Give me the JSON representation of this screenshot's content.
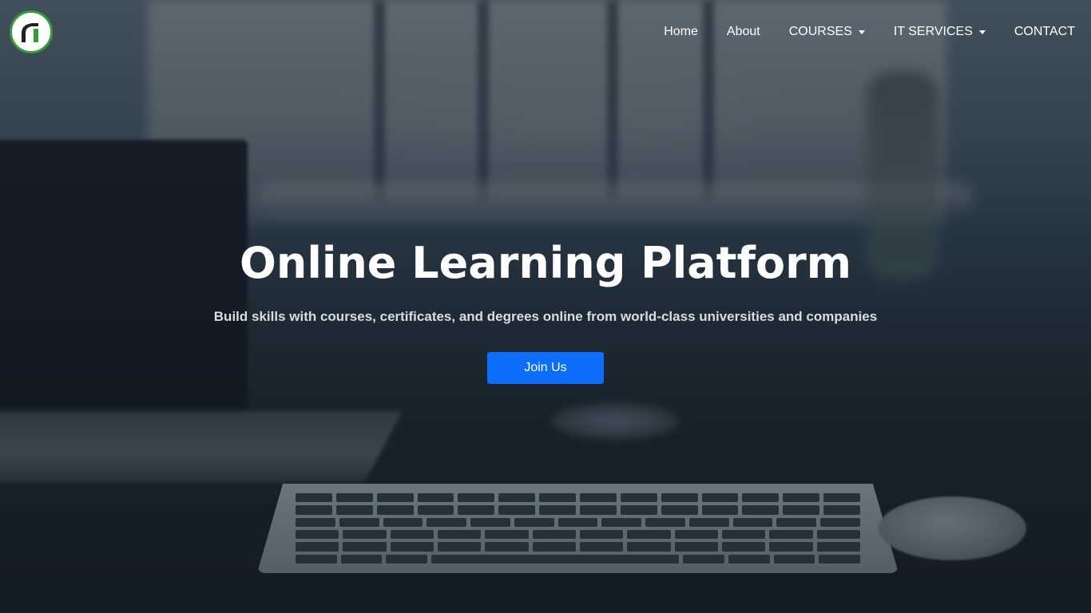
{
  "brand": {
    "logo_icon": "brand-logo-icon",
    "logo_ring_color": "#3a9b3a"
  },
  "nav": {
    "items": [
      {
        "label": "Home",
        "dropdown": false
      },
      {
        "label": "About",
        "dropdown": false
      },
      {
        "label": "COURSES",
        "dropdown": true
      },
      {
        "label": "IT SERVICES",
        "dropdown": true
      },
      {
        "label": "CONTACT",
        "dropdown": false
      }
    ]
  },
  "hero": {
    "title": "Online Learning Platform",
    "subtitle": "Build skills with courses, certificates, and degrees online from world-class universities and companies",
    "cta_label": "Join Us",
    "cta_color": "#0d6efd"
  }
}
